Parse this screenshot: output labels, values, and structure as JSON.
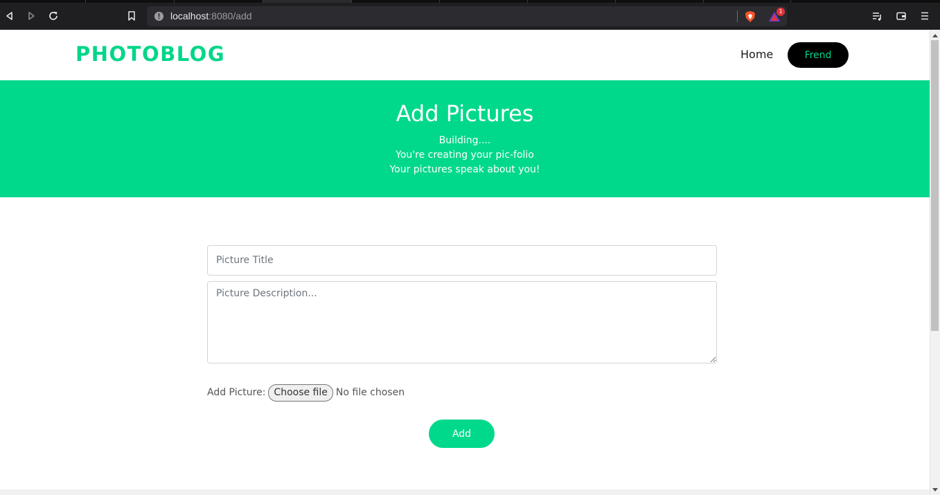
{
  "browser": {
    "url_host": "localhost",
    "url_path": ":8080/add",
    "rewards_badge": "1"
  },
  "navbar": {
    "brand": "PHOTOBLOG",
    "home_label": "Home",
    "frend_label": "Frend"
  },
  "hero": {
    "title": "Add Pictures",
    "line1": "Building....",
    "line2": "You're creating your pic-folio",
    "line3": "Your pictures speak about you!"
  },
  "form": {
    "title_placeholder": "Picture Title",
    "description_placeholder": "Picture Description...",
    "file_label": "Add Picture:",
    "choose_file_label": "Choose file",
    "no_file_text": "No file chosen",
    "submit_label": "Add"
  },
  "colors": {
    "accent": "#00d98b",
    "brand": "#00d688",
    "dark": "#000000"
  }
}
